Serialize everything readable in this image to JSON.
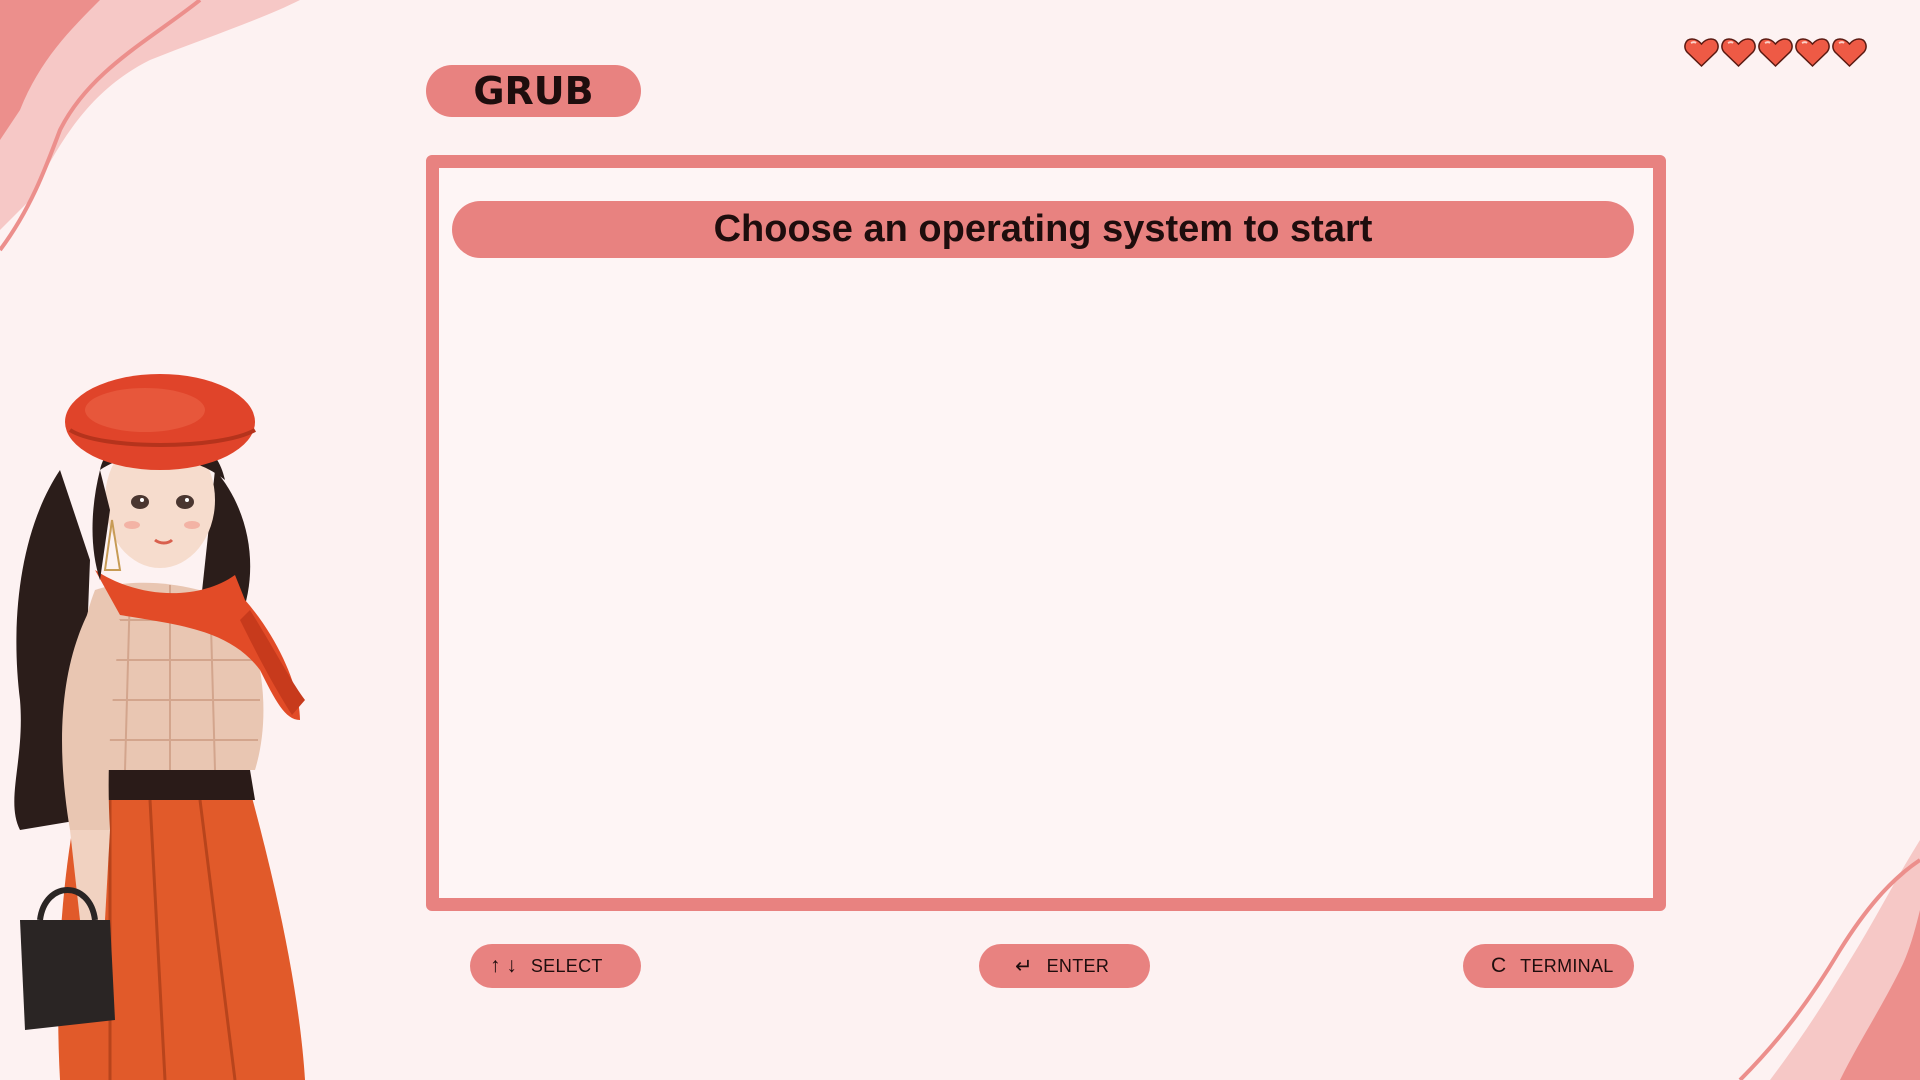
{
  "app": {
    "title": "GRUB"
  },
  "menu": {
    "header": "Choose an operating system to start",
    "entries": []
  },
  "status": {
    "lives_icon": "heart-icon",
    "lives": 5
  },
  "hints": {
    "select": {
      "keys": "↑ ↓",
      "label": "SELECT"
    },
    "enter": {
      "keys": "↵",
      "label": "ENTER"
    },
    "terminal": {
      "keys": "C",
      "label": "TERMINAL"
    }
  },
  "theme": {
    "accent": "#e88280",
    "background": "#fdf2f2",
    "text": "#1e0d0d",
    "heart": "#ee5a45"
  }
}
